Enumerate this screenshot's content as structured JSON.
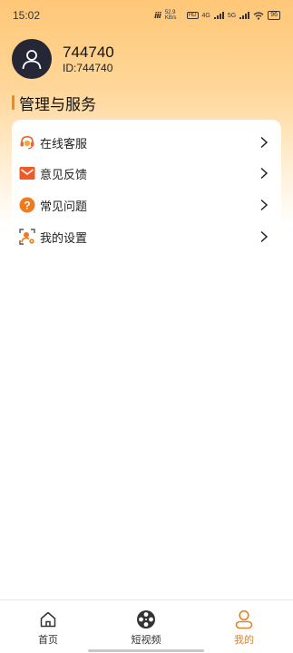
{
  "status_bar": {
    "time": "15:02",
    "net_speed": "52.9 KB/s",
    "sim1": "4G",
    "sim2": "5G",
    "battery": "96"
  },
  "profile": {
    "username": "744740",
    "user_id": "ID:744740"
  },
  "section": {
    "title": "管理与服务",
    "accent_color": "#f08a1a"
  },
  "menu": {
    "items": [
      {
        "label": "在线客服",
        "icon": "headset-icon"
      },
      {
        "label": "意见反馈",
        "icon": "mail-icon"
      },
      {
        "label": "常见问题",
        "icon": "question-icon"
      },
      {
        "label": "我的设置",
        "icon": "settings-user-icon"
      }
    ]
  },
  "tabbar": {
    "tabs": [
      {
        "label": "首页",
        "icon": "home-icon",
        "active": false
      },
      {
        "label": "短视频",
        "icon": "film-reel-icon",
        "active": false
      },
      {
        "label": "我的",
        "icon": "user-icon",
        "active": true
      }
    ],
    "active_color": "#e0842a"
  }
}
